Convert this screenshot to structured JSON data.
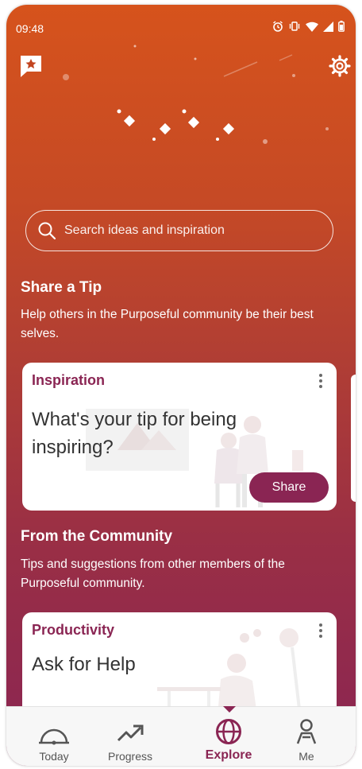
{
  "status_bar": {
    "time": "09:48",
    "icons": [
      "alarm-icon",
      "vibrate-icon",
      "wifi-icon",
      "signal-icon",
      "battery-icon"
    ]
  },
  "header": {
    "left_icon": "starred-message-icon",
    "right_icon": "gear-icon"
  },
  "search": {
    "placeholder": "Search ideas and inspiration"
  },
  "share_tip": {
    "title": "Share a Tip",
    "description": "Help others in the Purposeful community be their best selves."
  },
  "tip_card": {
    "category": "Inspiration",
    "prompt": "What's your tip for being inspiring?",
    "button_label": "Share"
  },
  "community": {
    "title": "From the Community",
    "description": "Tips and suggestions from other members of the Purposeful community."
  },
  "community_card": {
    "category": "Productivity",
    "text": "Ask for Help"
  },
  "nav": {
    "items": [
      {
        "label": "Today",
        "icon": "today-gauge-icon"
      },
      {
        "label": "Progress",
        "icon": "progress-arrow-icon"
      },
      {
        "label": "Explore",
        "icon": "explore-globe-icon"
      },
      {
        "label": "Me",
        "icon": "person-icon"
      }
    ],
    "active": "Explore"
  },
  "colors": {
    "accent": "#8a2553",
    "gradient_top": "#d6531c",
    "gradient_bottom": "#8a2553"
  }
}
